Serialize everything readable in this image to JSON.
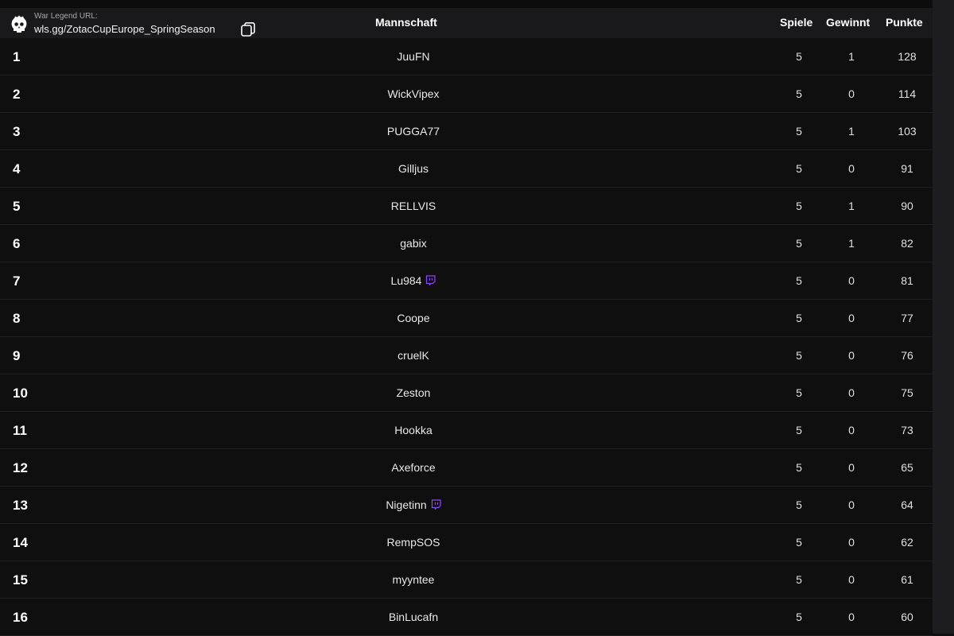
{
  "header": {
    "url_label": "War Legend URL:",
    "url_value": "wls.gg/ZotacCupEurope_SpringSeason",
    "columns": {
      "team": "Mannschaft",
      "games": "Spiele",
      "wins": "Gewinnt",
      "points": "Punkte"
    }
  },
  "colors": {
    "background": "#0f0f10",
    "header_bg": "#19191b",
    "twitch": "#9146ff"
  },
  "icons": {
    "logo": "flame-skull-icon",
    "copy": "copy-icon",
    "stream": "twitch-icon"
  },
  "rows": [
    {
      "rank": "1",
      "team": "JuuFN",
      "games": "5",
      "wins": "1",
      "points": "128",
      "twitch": false
    },
    {
      "rank": "2",
      "team": "WickVipex",
      "games": "5",
      "wins": "0",
      "points": "114",
      "twitch": false
    },
    {
      "rank": "3",
      "team": "PUGGA77",
      "games": "5",
      "wins": "1",
      "points": "103",
      "twitch": false
    },
    {
      "rank": "4",
      "team": "Gilljus",
      "games": "5",
      "wins": "0",
      "points": "91",
      "twitch": false
    },
    {
      "rank": "5",
      "team": "RELLVIS",
      "games": "5",
      "wins": "1",
      "points": "90",
      "twitch": false
    },
    {
      "rank": "6",
      "team": "gabix",
      "games": "5",
      "wins": "1",
      "points": "82",
      "twitch": false
    },
    {
      "rank": "7",
      "team": "Lu984",
      "games": "5",
      "wins": "0",
      "points": "81",
      "twitch": true
    },
    {
      "rank": "8",
      "team": "Coope",
      "games": "5",
      "wins": "0",
      "points": "77",
      "twitch": false
    },
    {
      "rank": "9",
      "team": "cruelK",
      "games": "5",
      "wins": "0",
      "points": "76",
      "twitch": false
    },
    {
      "rank": "10",
      "team": "Zeston",
      "games": "5",
      "wins": "0",
      "points": "75",
      "twitch": false
    },
    {
      "rank": "11",
      "team": "Hookka",
      "games": "5",
      "wins": "0",
      "points": "73",
      "twitch": false
    },
    {
      "rank": "12",
      "team": "Axeforce",
      "games": "5",
      "wins": "0",
      "points": "65",
      "twitch": false
    },
    {
      "rank": "13",
      "team": "Nigetinn",
      "games": "5",
      "wins": "0",
      "points": "64",
      "twitch": true
    },
    {
      "rank": "14",
      "team": "RempSOS",
      "games": "5",
      "wins": "0",
      "points": "62",
      "twitch": false
    },
    {
      "rank": "15",
      "team": "myyntee",
      "games": "5",
      "wins": "0",
      "points": "61",
      "twitch": false
    },
    {
      "rank": "16",
      "team": "BinLucafn",
      "games": "5",
      "wins": "0",
      "points": "60",
      "twitch": false
    }
  ]
}
